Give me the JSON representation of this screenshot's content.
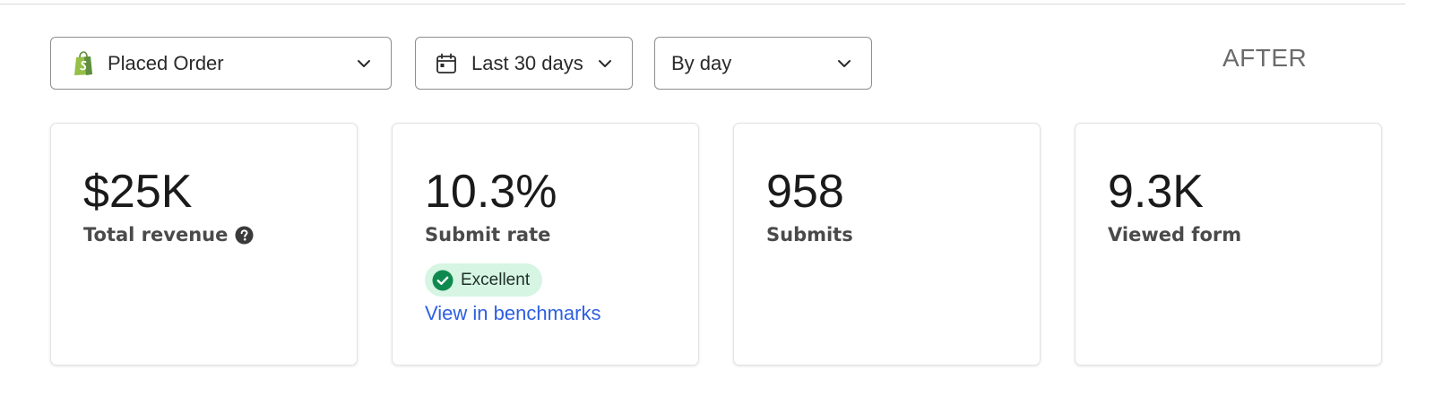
{
  "filters": {
    "metric": {
      "label": "Placed Order",
      "icon": "shopify-bag-icon"
    },
    "date_range": {
      "label": "Last 30 days",
      "icon": "calendar-icon"
    },
    "interval": {
      "label": "By day"
    }
  },
  "after_label": "AFTER",
  "cards": [
    {
      "value": "$25K",
      "caption": "Total revenue",
      "has_help": true
    },
    {
      "value": "10.3%",
      "caption": "Submit rate",
      "badge": {
        "label": "Excellent",
        "color": "#d6f5e3",
        "icon": "check-circle-icon"
      },
      "link": "View in benchmarks"
    },
    {
      "value": "958",
      "caption": "Submits"
    },
    {
      "value": "9.3K",
      "caption": "Viewed form"
    }
  ],
  "colors": {
    "link": "#2d5fe0",
    "badge_bg": "#d6f5e3",
    "badge_check": "#0f8a4e",
    "shopify_green": "#5e8e3e"
  }
}
